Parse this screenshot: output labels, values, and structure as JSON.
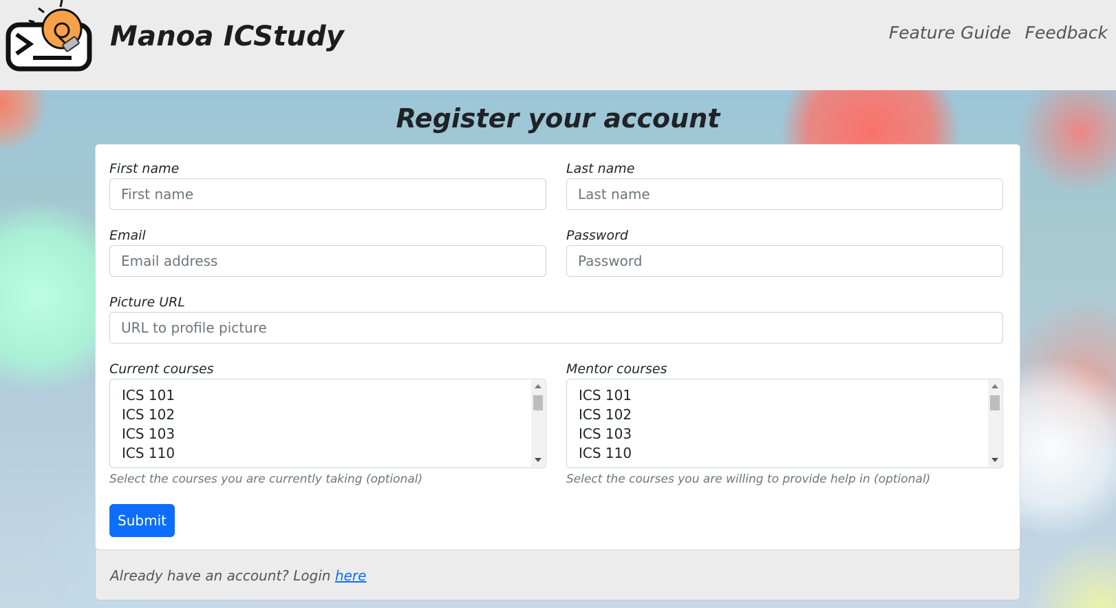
{
  "navbar": {
    "brand": "Manoa ICStudy",
    "links": [
      "Feature Guide",
      "Feedback"
    ]
  },
  "page": {
    "title": "Register your account"
  },
  "form": {
    "first_name": {
      "label": "First name",
      "placeholder": "First name",
      "value": ""
    },
    "last_name": {
      "label": "Last name",
      "placeholder": "Last name",
      "value": ""
    },
    "email": {
      "label": "Email",
      "placeholder": "Email address",
      "value": ""
    },
    "password": {
      "label": "Password",
      "placeholder": "Password",
      "value": ""
    },
    "picture": {
      "label": "Picture URL",
      "placeholder": "URL to profile picture",
      "value": ""
    },
    "current_courses": {
      "label": "Current courses",
      "options": [
        "ICS 101",
        "ICS 102",
        "ICS 103",
        "ICS 110"
      ],
      "help": "Select the courses you are currently taking (optional)"
    },
    "mentor_courses": {
      "label": "Mentor courses",
      "options": [
        "ICS 101",
        "ICS 102",
        "ICS 103",
        "ICS 110"
      ],
      "help": "Select the courses you are willing to provide help in (optional)"
    },
    "submit_label": "Submit"
  },
  "footer": {
    "text": "Already have an account? Login ",
    "link": "here"
  },
  "colors": {
    "primary": "#0d6efd",
    "navbar_bg": "#ececec",
    "logo_bulb": "#f7a14a"
  }
}
